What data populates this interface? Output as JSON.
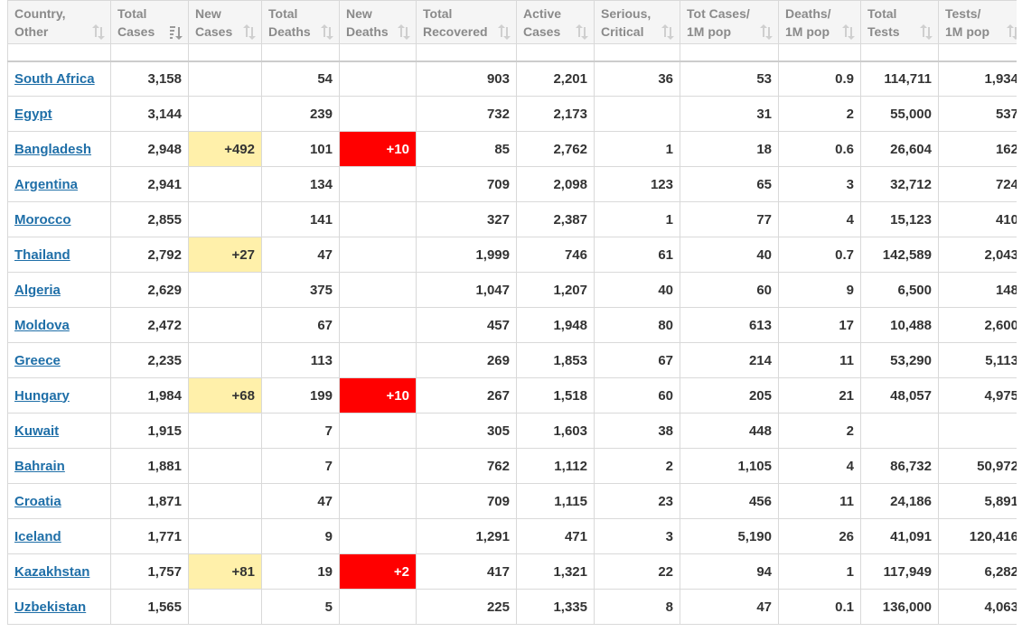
{
  "columns": [
    {
      "key": "country",
      "line1": "Country,",
      "line2": "Other"
    },
    {
      "key": "total_cases",
      "line1": "Total",
      "line2": "Cases",
      "sort_active": true
    },
    {
      "key": "new_cases",
      "line1": "New",
      "line2": "Cases"
    },
    {
      "key": "total_deaths",
      "line1": "Total",
      "line2": "Deaths"
    },
    {
      "key": "new_deaths",
      "line1": "New",
      "line2": "Deaths"
    },
    {
      "key": "total_recovered",
      "line1": "Total",
      "line2": "Recovered"
    },
    {
      "key": "active_cases",
      "line1": "Active",
      "line2": "Cases"
    },
    {
      "key": "serious_critical",
      "line1": "Serious,",
      "line2": "Critical"
    },
    {
      "key": "tot_cases_1m",
      "line1": "Tot Cases/",
      "line2": "1M pop"
    },
    {
      "key": "deaths_1m",
      "line1": "Deaths/",
      "line2": "1M pop"
    },
    {
      "key": "total_tests",
      "line1": "Total",
      "line2": "Tests"
    },
    {
      "key": "tests_1m",
      "line1": "Tests/",
      "line2": "1M pop"
    }
  ],
  "highlight_colors": {
    "new_cases": "#fff0aa",
    "new_deaths": "#ff0000",
    "link": "#1f6fa8"
  },
  "rows": [
    [
      "South Africa",
      "3,158",
      "",
      "54",
      "",
      "903",
      "2,201",
      "36",
      "53",
      "0.9",
      "114,711",
      "1,934"
    ],
    [
      "Egypt",
      "3,144",
      "",
      "239",
      "",
      "732",
      "2,173",
      "",
      "31",
      "2",
      "55,000",
      "537"
    ],
    [
      "Bangladesh",
      "2,948",
      "+492",
      "101",
      "+10",
      "85",
      "2,762",
      "1",
      "18",
      "0.6",
      "26,604",
      "162"
    ],
    [
      "Argentina",
      "2,941",
      "",
      "134",
      "",
      "709",
      "2,098",
      "123",
      "65",
      "3",
      "32,712",
      "724"
    ],
    [
      "Morocco",
      "2,855",
      "",
      "141",
      "",
      "327",
      "2,387",
      "1",
      "77",
      "4",
      "15,123",
      "410"
    ],
    [
      "Thailand",
      "2,792",
      "+27",
      "47",
      "",
      "1,999",
      "746",
      "61",
      "40",
      "0.7",
      "142,589",
      "2,043"
    ],
    [
      "Algeria",
      "2,629",
      "",
      "375",
      "",
      "1,047",
      "1,207",
      "40",
      "60",
      "9",
      "6,500",
      "148"
    ],
    [
      "Moldova",
      "2,472",
      "",
      "67",
      "",
      "457",
      "1,948",
      "80",
      "613",
      "17",
      "10,488",
      "2,600"
    ],
    [
      "Greece",
      "2,235",
      "",
      "113",
      "",
      "269",
      "1,853",
      "67",
      "214",
      "11",
      "53,290",
      "5,113"
    ],
    [
      "Hungary",
      "1,984",
      "+68",
      "199",
      "+10",
      "267",
      "1,518",
      "60",
      "205",
      "21",
      "48,057",
      "4,975"
    ],
    [
      "Kuwait",
      "1,915",
      "",
      "7",
      "",
      "305",
      "1,603",
      "38",
      "448",
      "2",
      "",
      ""
    ],
    [
      "Bahrain",
      "1,881",
      "",
      "7",
      "",
      "762",
      "1,112",
      "2",
      "1,105",
      "4",
      "86,732",
      "50,972"
    ],
    [
      "Croatia",
      "1,871",
      "",
      "47",
      "",
      "709",
      "1,115",
      "23",
      "456",
      "11",
      "24,186",
      "5,891"
    ],
    [
      "Iceland",
      "1,771",
      "",
      "9",
      "",
      "1,291",
      "471",
      "3",
      "5,190",
      "26",
      "41,091",
      "120,416"
    ],
    [
      "Kazakhstan",
      "1,757",
      "+81",
      "19",
      "+2",
      "417",
      "1,321",
      "22",
      "94",
      "1",
      "117,949",
      "6,282"
    ],
    [
      "Uzbekistan",
      "1,565",
      "",
      "5",
      "",
      "225",
      "1,335",
      "8",
      "47",
      "0.1",
      "136,000",
      "4,063"
    ]
  ]
}
